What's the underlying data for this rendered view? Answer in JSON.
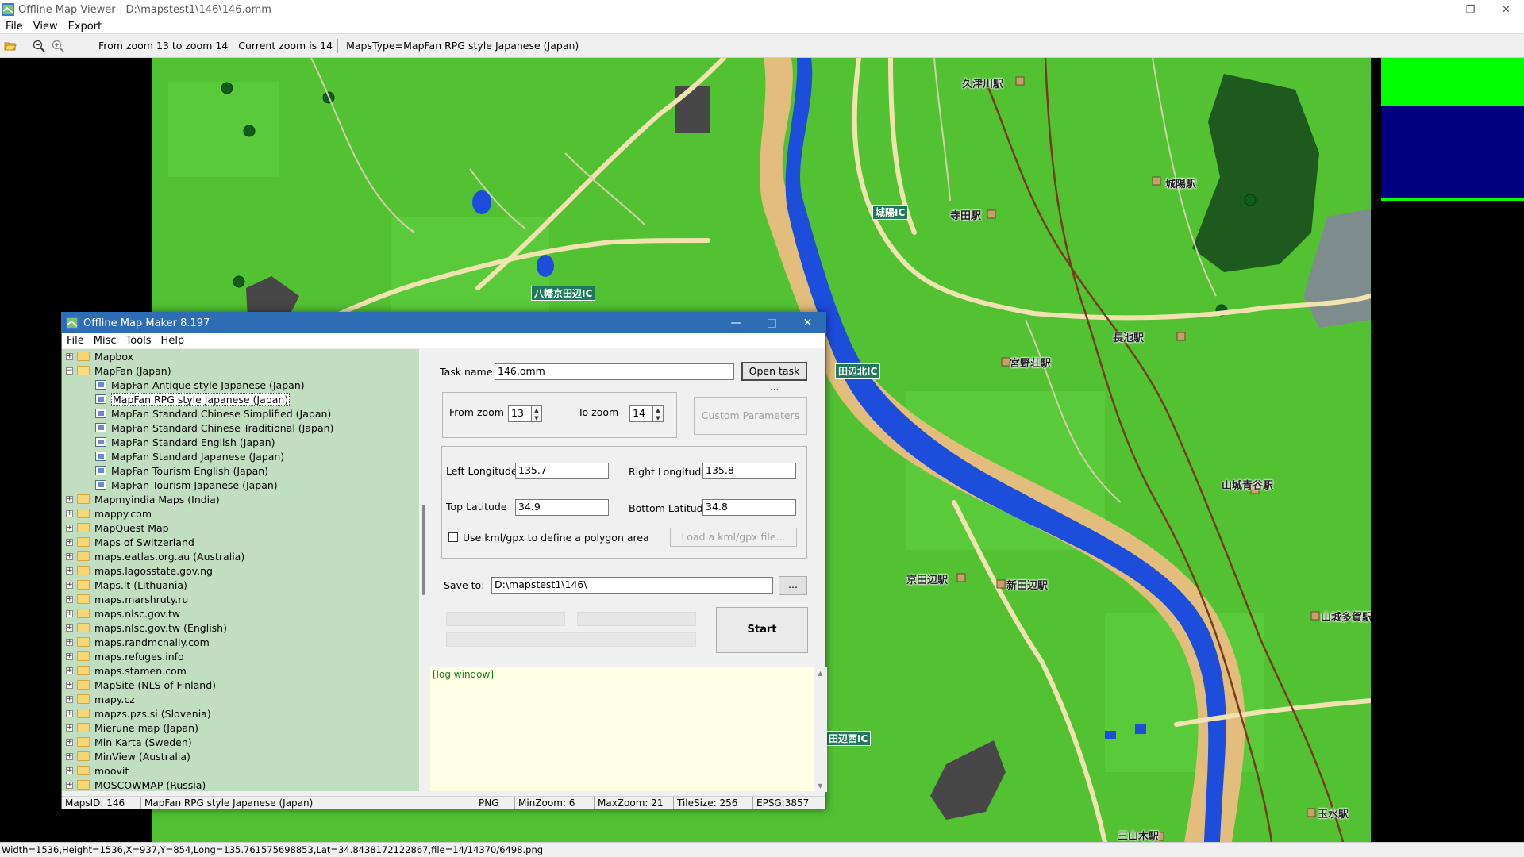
{
  "window": {
    "title": "Offline Map Viewer - D:\\mapstest1\\146\\146.omm"
  },
  "menu": [
    "File",
    "View",
    "Export"
  ],
  "toolbar": {
    "zoom_range": "From zoom 13 to zoom 14",
    "current_zoom": "Current zoom is 14",
    "maps_type": "MapsType=MapFan RPG style Japanese (Japan)"
  },
  "map": {
    "labels": [
      "久津川駅",
      "城陽駅",
      "寺田駅",
      "宮野荘駅",
      "長池駅",
      "山城青谷駅",
      "京田辺駅",
      "新田辺駅",
      "山城多賀駅",
      "三山木駅",
      "玉水駅"
    ],
    "ic_labels": [
      "八幡京田辺IC",
      "城陽IC",
      "田辺北IC",
      "田辺西IC"
    ]
  },
  "status": "Width=1536,Height=1536,X=937,Y=854,Long=135.761575698853,Lat=34.8438172122867,file=14/14370/6498.png",
  "dialog": {
    "title": "Offline Map Maker 8.197",
    "menu": [
      "File",
      "Misc",
      "Tools",
      "Help"
    ],
    "tree": [
      {
        "label": "Mapbox",
        "type": "folder",
        "expanded": false
      },
      {
        "label": "MapFan (Japan)",
        "type": "folder",
        "expanded": true
      },
      {
        "label": "MapFan Antique style Japanese (Japan)",
        "type": "map"
      },
      {
        "label": "MapFan RPG style Japanese (Japan)",
        "type": "map",
        "selected": true
      },
      {
        "label": "MapFan Standard Chinese Simplified (Japan)",
        "type": "map"
      },
      {
        "label": "MapFan Standard Chinese Traditional (Japan)",
        "type": "map"
      },
      {
        "label": "MapFan Standard English (Japan)",
        "type": "map"
      },
      {
        "label": "MapFan Standard Japanese (Japan)",
        "type": "map"
      },
      {
        "label": "MapFan Tourism English (Japan)",
        "type": "map"
      },
      {
        "label": "MapFan Tourism Japanese (Japan)",
        "type": "map"
      },
      {
        "label": "Mapmyindia Maps (India)",
        "type": "folder"
      },
      {
        "label": "mappy.com",
        "type": "folder"
      },
      {
        "label": "MapQuest Map",
        "type": "folder"
      },
      {
        "label": "Maps of Switzerland",
        "type": "folder"
      },
      {
        "label": "maps.eatlas.org.au (Australia)",
        "type": "folder"
      },
      {
        "label": "maps.lagosstate.gov.ng",
        "type": "folder"
      },
      {
        "label": "Maps.lt (Lithuania)",
        "type": "folder"
      },
      {
        "label": "maps.marshruty.ru",
        "type": "folder"
      },
      {
        "label": "maps.nlsc.gov.tw",
        "type": "folder"
      },
      {
        "label": "maps.nlsc.gov.tw (English)",
        "type": "folder"
      },
      {
        "label": "maps.randmcnally.com",
        "type": "folder"
      },
      {
        "label": "maps.refuges.info",
        "type": "folder"
      },
      {
        "label": "maps.stamen.com",
        "type": "folder"
      },
      {
        "label": "MapSite (NLS of Finland)",
        "type": "folder"
      },
      {
        "label": "mapy.cz",
        "type": "folder"
      },
      {
        "label": "mapzs.pzs.si (Slovenia)",
        "type": "folder"
      },
      {
        "label": "Mierune map (Japan)",
        "type": "folder"
      },
      {
        "label": "Min Karta (Sweden)",
        "type": "folder"
      },
      {
        "label": "MinView (Australia)",
        "type": "folder"
      },
      {
        "label": "moovit",
        "type": "folder"
      },
      {
        "label": "MOSCOWMAP (Russia)",
        "type": "folder"
      }
    ],
    "task_name_label": "Task name",
    "task_name_value": "146.omm",
    "open_task": "Open task ...",
    "from_zoom_label": "From zoom",
    "from_zoom_value": "13",
    "to_zoom_label": "To zoom",
    "to_zoom_value": "14",
    "custom_params": "Custom Parameters",
    "left_lon_label": "Left Longitude",
    "left_lon_value": "135.7",
    "right_lon_label": "Right Longitude",
    "right_lon_value": "135.8",
    "top_lat_label": "Top Latitude",
    "top_lat_value": "34.9",
    "bottom_lat_label": "Bottom Latitude",
    "bottom_lat_value": "34.8",
    "kml_checkbox": "Use kml/gpx to define a polygon area",
    "load_kml": "Load a kml/gpx file...",
    "save_to_label": "Save to:",
    "save_to_value": "D:\\mapstest1\\146\\",
    "browse": "...",
    "start": "Start",
    "log": "[log window]",
    "status": {
      "maps_id": "MapsID: 146",
      "maps_name": "MapFan RPG style Japanese (Japan)",
      "format": "PNG",
      "min_zoom": "MinZoom: 6",
      "max_zoom": "MaxZoom: 21",
      "tile_size": "TileSize: 256",
      "epsg": "EPSG:3857"
    }
  }
}
